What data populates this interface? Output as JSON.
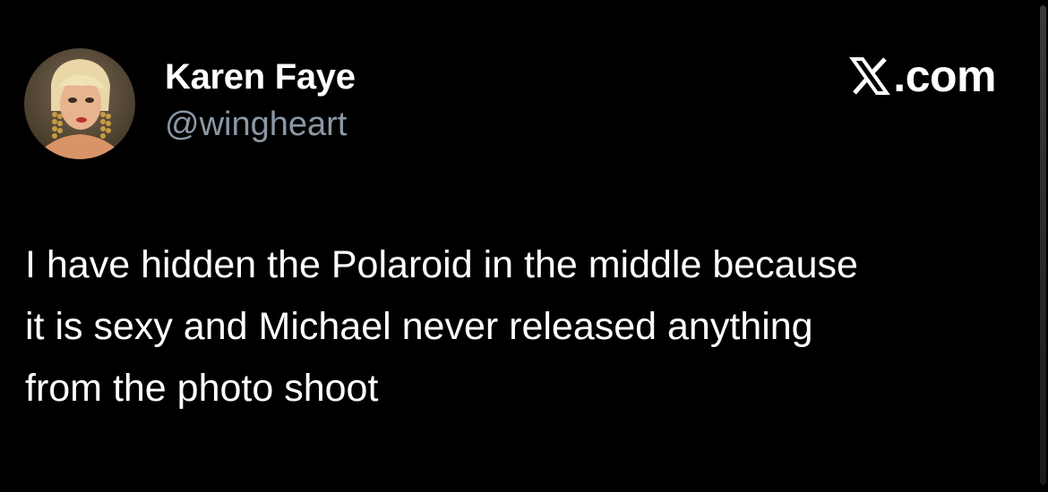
{
  "tweet": {
    "author": {
      "display_name": "Karen Faye",
      "handle": "@wingheart",
      "avatar_icon": "profile-photo"
    },
    "brand": {
      "logo_icon": "x-logo-icon",
      "text": ".com"
    },
    "body_lines": [
      "I have hidden the Polaroid in the middle because",
      "it is sexy and Michael never released anything",
      "from the photo shoot"
    ]
  },
  "colors": {
    "background": "#000000",
    "text_primary": "#ffffff",
    "text_secondary": "#8b98a5"
  }
}
